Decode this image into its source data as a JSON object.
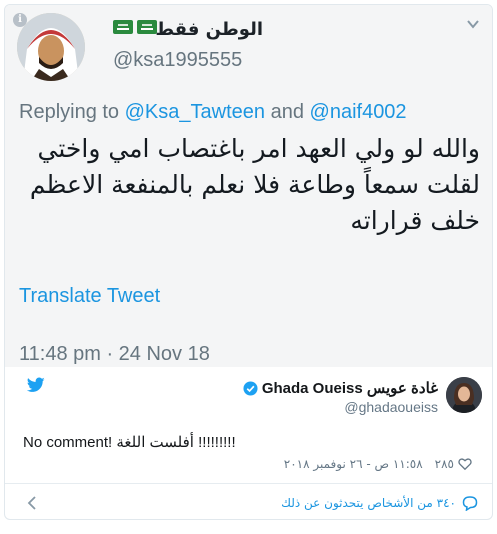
{
  "screenshot": {
    "display_name": "الوطن فقط",
    "handle": "@ksa1995555",
    "replying_prefix": "Replying to",
    "reply_user_1": "@Ksa_Tawteen",
    "reply_and": "and",
    "reply_user_2": "@naif4002",
    "text": "والله لو ولي العهد امر باغتصاب امي واختي لقلت سمعاً وطاعة فلا نعلم بالمنفعة الاعظم خلف قراراته",
    "translate_label": "Translate Tweet",
    "timestamp": "11:48 pm · 24 Nov 18"
  },
  "tweet": {
    "display_name": "Ghada Oueiss غادة عويس",
    "handle": "@ghadaoueiss",
    "text_a": "No comment!",
    "text_b": "أفلست اللغة",
    "text_c": "!!!!!!!!!",
    "likes": "٢٨٥",
    "timestamp": "١١:٥٨ ص - ٢٦ نوفمبر ٢٠١٨",
    "conversation_link": "٣٤٠ من الأشخاص يتحدثون عن ذلك"
  },
  "colors": {
    "link_blue": "#1b95e0",
    "twitter_blue": "#1da1f2",
    "muted": "#657786"
  },
  "icons": [
    "info-icon",
    "twitter-bird-icon",
    "verified-badge-icon",
    "heart-icon",
    "chat-bubble-icon",
    "chevron-left-icon",
    "chevron-down-icon",
    "saudi-flag-icon"
  ]
}
